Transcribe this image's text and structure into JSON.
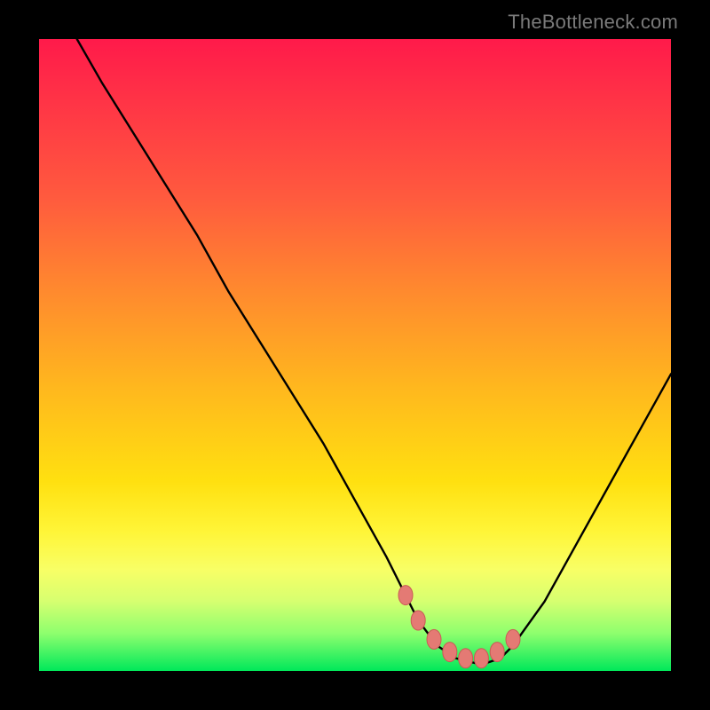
{
  "watermark": "TheBottleneck.com",
  "colors": {
    "curve_stroke": "#000000",
    "marker_fill": "#e47a74",
    "marker_stroke": "#c95b55"
  },
  "chart_data": {
    "type": "line",
    "title": "",
    "xlabel": "",
    "ylabel": "",
    "xlim": [
      0,
      100
    ],
    "ylim": [
      0,
      100
    ],
    "grid": false,
    "legend": false,
    "series": [
      {
        "name": "curve",
        "x": [
          6,
          10,
          15,
          20,
          25,
          30,
          35,
          40,
          45,
          50,
          55,
          58,
          60,
          63,
          66,
          70,
          73,
          75,
          80,
          85,
          90,
          95,
          100
        ],
        "values": [
          100,
          93,
          85,
          77,
          69,
          60,
          52,
          44,
          36,
          27,
          18,
          12,
          8,
          4,
          2,
          1,
          2,
          4,
          11,
          20,
          29,
          38,
          47
        ]
      }
    ],
    "flat_region_x": [
      58,
      75
    ],
    "markers": [
      {
        "x": 58,
        "y": 12
      },
      {
        "x": 60,
        "y": 8
      },
      {
        "x": 62.5,
        "y": 5
      },
      {
        "x": 65,
        "y": 3
      },
      {
        "x": 67.5,
        "y": 2
      },
      {
        "x": 70,
        "y": 2
      },
      {
        "x": 72.5,
        "y": 3
      },
      {
        "x": 75,
        "y": 5
      }
    ]
  }
}
